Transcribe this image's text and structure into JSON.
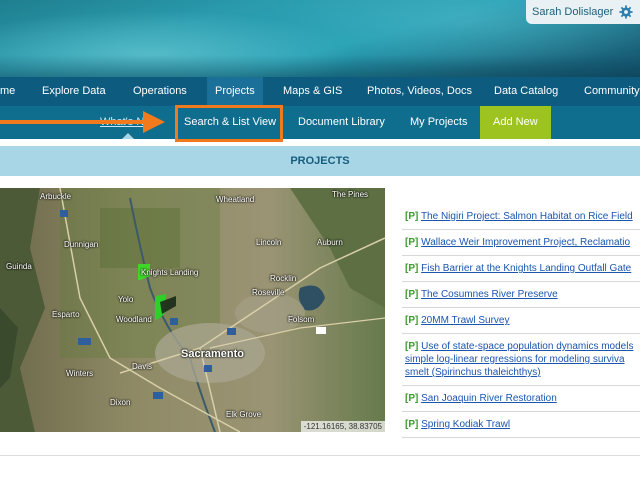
{
  "user": {
    "name": "Sarah Dolislager",
    "settings_icon": "gear-icon"
  },
  "main_nav": {
    "items": [
      "me",
      "Explore Data",
      "Operations",
      "Projects",
      "Maps & GIS",
      "Photos, Videos, Docs",
      "Data Catalog",
      "Community"
    ],
    "active": "Projects"
  },
  "sub_nav": {
    "whats_new": "What's N",
    "search_list": "Search & List View",
    "document_library": "Document Library",
    "my_projects": "My Projects",
    "add_new": "Add New"
  },
  "section_title": "PROJECTS",
  "map": {
    "labels": [
      "Arbuckle",
      "Wheatland",
      "The Pines",
      "Dunnigan",
      "Lincoln",
      "Auburn",
      "Guinda",
      "Knights Landing",
      "Rocklin",
      "Roseville",
      "Yolo",
      "Esparto",
      "Woodland",
      "Folsom",
      "Sacramento",
      "Davis",
      "Winters",
      "Dixon",
      "Elk Grove"
    ],
    "route_labels": [
      "5",
      "80",
      "5",
      "505",
      "50",
      "5",
      "80"
    ],
    "coordinates": "-121.16165, 38.83705"
  },
  "projects": [
    {
      "tag": "[P]",
      "title": "The Nigiri Project: Salmon Habitat on Rice Field"
    },
    {
      "tag": "[P]",
      "title": "Wallace Weir Improvement Project, Reclamatio"
    },
    {
      "tag": "[P]",
      "title": "Fish Barrier at the Knights Landing Outfall Gate"
    },
    {
      "tag": "[P]",
      "title": "The Cosumnes River Preserve"
    },
    {
      "tag": "[P]",
      "title": "20MM Trawl Survey"
    },
    {
      "tag": "[P]",
      "title": "Use of state-space population dynamics models",
      "line2": "simple log-linear regressions for modeling surviva",
      "line3": "smelt (Spirinchus thaleichthys)"
    },
    {
      "tag": "[P]",
      "title": "San Joaquin River Restoration"
    },
    {
      "tag": "[P]",
      "title": "Spring Kodiak Trawl"
    }
  ],
  "colors": {
    "nav": "#0d5c80",
    "subnav": "#0f6d8e",
    "accent_green": "#9cc31f",
    "annotation": "#f07a1c",
    "section_bar": "#a9d6e6"
  }
}
